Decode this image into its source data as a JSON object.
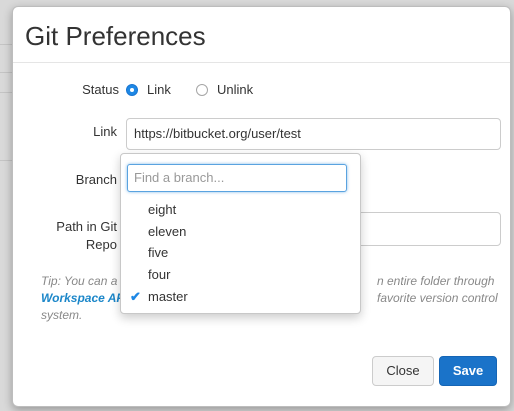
{
  "dialog": {
    "title": "Git Preferences"
  },
  "form": {
    "status_label": "Status",
    "status_options": [
      {
        "label": "Link",
        "checked": true
      },
      {
        "label": "Unlink",
        "checked": false
      }
    ],
    "link_label": "Link",
    "link_value": "https://bitbucket.org/user/test",
    "branch_label": "Branch",
    "path_label_line1": "Path in Git",
    "path_label_line2": "Repo",
    "path_value": ""
  },
  "tip": {
    "prefix": "Tip: You can a",
    "middle": "n entire folder through",
    "link": "Workspace AP",
    "suffix": "favorite version control",
    "last_line": "system."
  },
  "branch_dropdown": {
    "search_placeholder": "Find a branch...",
    "items": [
      {
        "label": "eight",
        "selected": false
      },
      {
        "label": "eleven",
        "selected": false
      },
      {
        "label": "five",
        "selected": false
      },
      {
        "label": "four",
        "selected": false
      },
      {
        "label": "master",
        "selected": true
      }
    ],
    "check_glyph": "✔"
  },
  "buttons": {
    "close": "Close",
    "save": "Save"
  },
  "colors": {
    "accent": "#1e88e5",
    "save_button": "#1a73c9",
    "link_text": "#1c87c9"
  }
}
